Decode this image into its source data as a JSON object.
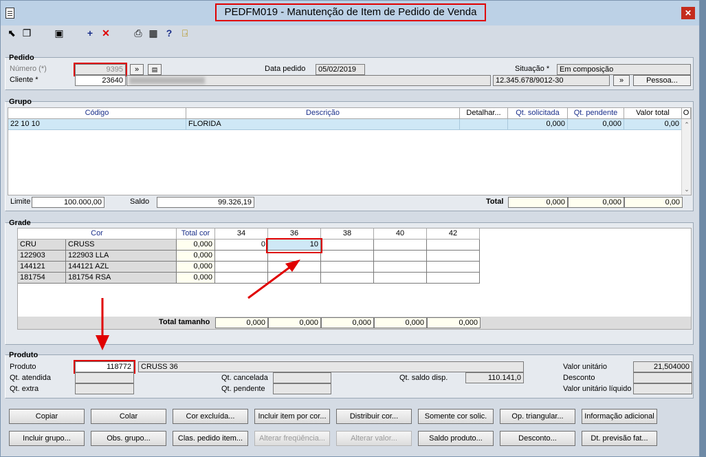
{
  "window": {
    "title": "PEDFM019 - Manutenção de Item de Pedido de Venda"
  },
  "toolbar": {
    "icons": [
      "arrow-icon",
      "copy-icon",
      "save-icon",
      "add-icon",
      "delete-icon",
      "print-icon",
      "calculator-icon",
      "help-icon",
      "exit-icon"
    ]
  },
  "pedido": {
    "legend": "Pedido",
    "numero_label": "Número (*)",
    "numero_value": "9395",
    "nav_btn": "»",
    "data_label": "Data pedido",
    "data_value": "05/02/2019",
    "situacao_label": "Situação *",
    "situacao_value": "Em composição",
    "cliente_label": "Cliente *",
    "cliente_value": "23640",
    "cliente_doc": "12.345.678/9012-30",
    "cliente_nav_btn": "»",
    "pessoa_btn": "Pessoa..."
  },
  "grupo": {
    "legend": "Grupo",
    "columns": [
      "Código",
      "Descrição",
      "Detalhar...",
      "Qt. solicitada",
      "Qt. pendente",
      "Valor total",
      "O"
    ],
    "rows": [
      {
        "codigo": "22 10 10",
        "descricao": "FLORIDA",
        "detalhar": "",
        "qt_solicitada": "0,000",
        "qt_pendente": "0,000",
        "valor_total": "0,00"
      }
    ],
    "limite_label": "Limite",
    "limite_value": "100.000,00",
    "saldo_label": "Saldo",
    "saldo_value": "99.326,19",
    "total_label": "Total",
    "total_solicitada": "0,000",
    "total_pendente": "0,000",
    "total_valor": "0,00"
  },
  "grade": {
    "legend": "Grade",
    "header_cor": "Cor",
    "header_total": "Total cor",
    "sizes": [
      "34",
      "36",
      "38",
      "40",
      "42"
    ],
    "rows": [
      {
        "code": "CRU",
        "name": "CRUSS",
        "total": "0,000",
        "v34": "0",
        "v36": "10",
        "v38": "",
        "v40": "",
        "v42": ""
      },
      {
        "code": "122903",
        "name": "122903 LLA",
        "total": "0,000",
        "v34": "",
        "v36": "",
        "v38": "",
        "v40": "",
        "v42": ""
      },
      {
        "code": "144121",
        "name": "144121 AZL",
        "total": "0,000",
        "v34": "",
        "v36": "",
        "v38": "",
        "v40": "",
        "v42": ""
      },
      {
        "code": "181754",
        "name": "181754 RSA",
        "total": "0,000",
        "v34": "",
        "v36": "",
        "v38": "",
        "v40": "",
        "v42": ""
      }
    ],
    "total_tamanho_label": "Total tamanho",
    "total_tamanho": [
      "0,000",
      "0,000",
      "0,000",
      "0,000",
      "0,000"
    ]
  },
  "produto": {
    "legend": "Produto",
    "produto_label": "Produto",
    "produto_value": "118772",
    "produto_desc": "CRUSS 36",
    "qt_atendida_label": "Qt. atendida",
    "qt_extra_label": "Qt. extra",
    "qt_cancelada_label": "Qt. cancelada",
    "qt_pendente_label": "Qt. pendente",
    "qt_saldo_label": "Qt. saldo disp.",
    "qt_saldo_value": "110.141,0",
    "valor_unitario_label": "Valor unitário",
    "valor_unitario_value": "21,504000",
    "desconto_label": "Desconto",
    "valor_liquido_label": "Valor unitário líquido"
  },
  "buttons": {
    "row1": [
      "Copiar",
      "Colar",
      "Cor excluída...",
      "Incluir item por cor...",
      "Distribuir cor...",
      "Somente cor solic.",
      "Op. triangular...",
      "Informação adicional"
    ],
    "row2": [
      "Incluir grupo...",
      "Obs. grupo...",
      "Clas. pedido item...",
      "Alterar freqüência...",
      "Alterar valor...",
      "Saldo produto...",
      "Desconto...",
      "Dt. previsão fat..."
    ]
  },
  "colors": {
    "annotation_red": "#e00000",
    "selected_row": "#cfe8f6",
    "titlebar": "#bcd1e6"
  }
}
